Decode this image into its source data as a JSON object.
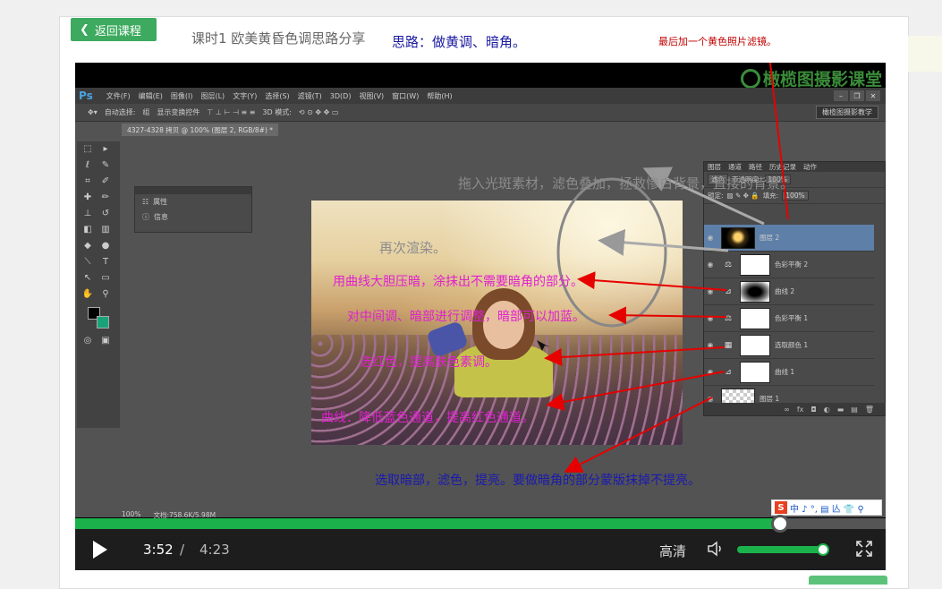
{
  "header": {
    "back_label": "返回课程",
    "lesson_title": "课时1  欧美黄昏色调思路分享",
    "idea_note": "思路：做黄调、暗角。",
    "filter_note": "最后加一个黄色照片滤镜。"
  },
  "video": {
    "watermark": "橄榄图摄影课堂",
    "current_time": "3:52",
    "separator": "/",
    "total_time": "4:23",
    "quality": "高清",
    "progress": 0.87,
    "volume": 0.96
  },
  "photoshop": {
    "menu": [
      "文件(F)",
      "编辑(E)",
      "图像(I)",
      "图层(L)",
      "文字(Y)",
      "选择(S)",
      "滤镜(T)",
      "3D(D)",
      "视图(V)",
      "窗口(W)",
      "帮助(H)"
    ],
    "options": {
      "auto_select": "自动选择:",
      "auto_select_value": "组",
      "show_transform": "显示变换控件",
      "mode_3d": "3D 模式:",
      "workspace": "橄榄图摄影教学"
    },
    "doc_tab": "4327-4328 拷贝 @ 100% (图层 2, RGB/8#) *",
    "props_panel": [
      "属性",
      "信息"
    ],
    "status": {
      "zoom": "100%",
      "doc": "文档:758.6K/5.98M"
    },
    "layers_panel": {
      "tabs": [
        "图层",
        "通道",
        "路径",
        "历史记录",
        "动作"
      ],
      "blend_mode": "滤色",
      "opacity_label": "不透明度:",
      "opacity": "100%",
      "lock_label": "锁定:",
      "fill_label": "填充:",
      "fill": "100%",
      "layers": [
        "图层 2",
        "色彩平衡 2",
        "曲线 2",
        "色彩平衡 1",
        "选取颜色 1",
        "曲线 1",
        "图层 1"
      ]
    }
  },
  "annotations": {
    "light_spot": "拖入光斑素材，滤色叠加，拯救惨白背景，直接的背景。",
    "re_render": "再次渲染。",
    "curves_dark": "用曲线大胆压暗，涂抹出不需要暗角的部分。",
    "midtones": "对中间调、暗部进行调整，暗部可以加蓝。",
    "selective": "选红色，提高肤色素调。",
    "curves_blue": "曲线：降低蓝色通道，提高红色通道。",
    "select_dark": "选取暗部，滤色，提亮。要做暗角的部分蒙版抹掉不提亮。"
  },
  "ime": {
    "logo": "S",
    "items": "中 ♪ °, ▤ 亾 👕 ⚲"
  },
  "colors": {
    "accent": "#1bb24b",
    "annotation_arrow": "#e60000",
    "annotation_text": "#e020d0"
  }
}
